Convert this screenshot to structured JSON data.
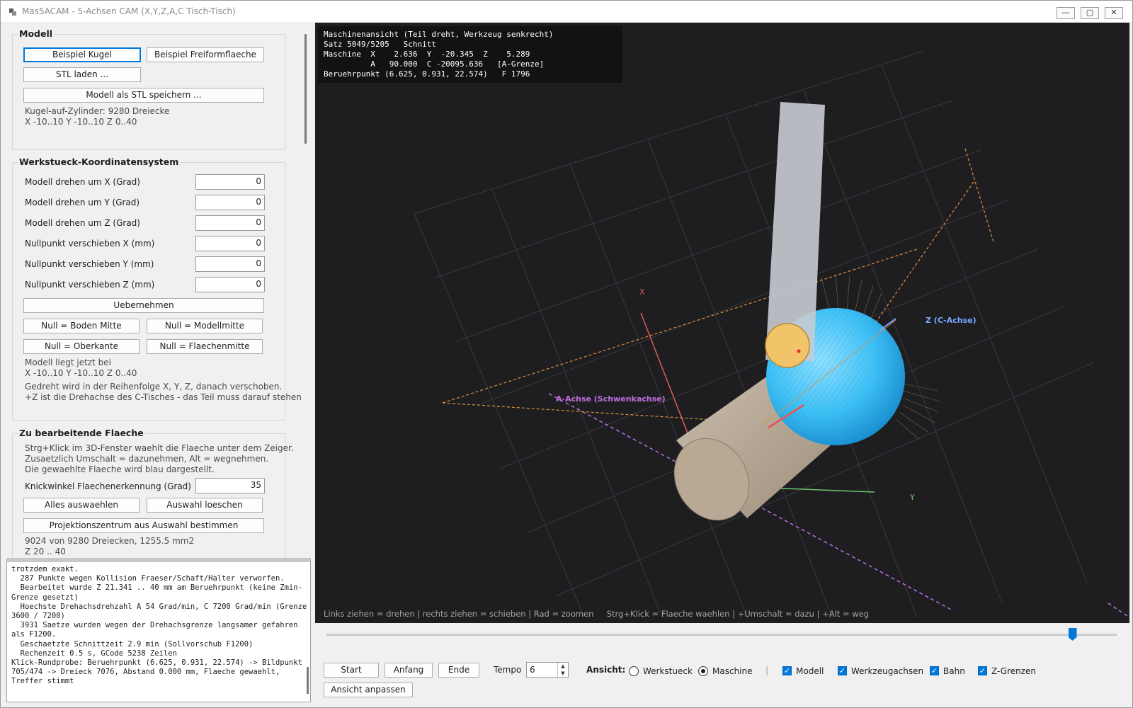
{
  "window": {
    "title": "Mas5ACAM - 5-Achsen CAM (X,Y,Z,A,C Tisch-Tisch)",
    "min_glyph": "—",
    "max_glyph": "▢",
    "close_glyph": "✕"
  },
  "modell": {
    "title": "Modell",
    "btn_kugel": "Beispiel Kugel",
    "btn_freiform": "Beispiel Freiformflaeche",
    "btn_stl_laden": "STL laden ...",
    "btn_stl_speichern": "Modell als STL speichern ...",
    "info1": "Kugel-auf-Zylinder: 9280 Dreiecke",
    "info2": "X -10..10  Y -10..10  Z 0..40"
  },
  "wks": {
    "title": "Werkstueck-Koordinatensystem",
    "rows": [
      {
        "label": "Modell drehen um X (Grad)",
        "value": "0"
      },
      {
        "label": "Modell drehen um Y (Grad)",
        "value": "0"
      },
      {
        "label": "Modell drehen um Z (Grad)",
        "value": "0"
      },
      {
        "label": "Nullpunkt verschieben X (mm)",
        "value": "0"
      },
      {
        "label": "Nullpunkt verschieben Y (mm)",
        "value": "0"
      },
      {
        "label": "Nullpunkt verschieben Z (mm)",
        "value": "0"
      }
    ],
    "btn_uebernehmen": "Uebernehmen",
    "btn_boden_mitte": "Null = Boden Mitte",
    "btn_modellmitte": "Null = Modellmitte",
    "btn_oberkante": "Null = Oberkante",
    "btn_flaechenmitte": "Null = Flaechenmitte",
    "info1": "Modell liegt jetzt bei",
    "info2": "X -10..10   Y -10..10   Z 0..40",
    "info3": "Gedreht wird in der Reihenfolge X, Y, Z, danach verschoben.",
    "info4": "+Z ist die Drehachse des C-Tisches - das Teil muss darauf stehen."
  },
  "flaeche": {
    "title": "Zu bearbeitende Flaeche",
    "info1": "Strg+Klick im 3D-Fenster waehlt die Flaeche unter dem Zeiger.",
    "info2": "Zusaetzlich Umschalt = dazunehmen, Alt = wegnehmen.",
    "info3": "Die gewaehlte Flaeche wird blau dargestellt.",
    "knick_label": "Knickwinkel Flaechenerkennung (Grad)",
    "knick_value": "35",
    "btn_alles": "Alles auswaehlen",
    "btn_loeschen": "Auswahl loeschen",
    "btn_projektion": "Projektionszentrum aus Auswahl bestimmen",
    "info4": "9024 von 9280 Dreiecken, 1255.5 mm2",
    "info5": "Z 20 .. 40"
  },
  "log": {
    "lines": [
      "trotzdem exakt.",
      "  287 Punkte wegen Kollision Fraeser/Schaft/Halter verworfen.",
      "  Bearbeitet wurde Z 21.341 .. 40 mm am Beruehrpunkt (keine Zmin-",
      "Grenze gesetzt)",
      "  Hoechste Drehachsdrehzahl A 54 Grad/min, C 7200 Grad/min (Grenze",
      "3600 / 7200)",
      "  3931 Saetze wurden wegen der Drehachsgrenze langsamer gefahren",
      "als F1200.",
      "  Geschaetzte Schnittzeit 2.9 min (Sollvorschub F1200)",
      "  Rechenzeit 0.5 s, GCode 5238 Zeilen",
      "Klick-Rundprobe: Beruehrpunkt (6.625, 0.931, 22.574) -> Bildpunkt",
      "705/474 -> Dreieck 7076, Abstand 0.000 mm, Flaeche gewaehlt,",
      "Treffer stimmt"
    ]
  },
  "viewport": {
    "overlay_lines": [
      "Maschinenansicht (Teil dreht, Werkzeug senkrecht)",
      "Satz 5049/5205   Schnitt",
      "Maschine  X    2.636  Y  -20.345  Z    5.289",
      "          A   90.000  C -20095.636   [A-Grenze]",
      "Beruehrpunkt (6.625, 0.931, 22.574)   F 1796"
    ],
    "label_x": "X",
    "label_y": "Y",
    "label_z": "Z (C-Achse)",
    "label_a": "A-Achse (Schwenkachse)",
    "hint": "Links ziehen = drehen | rechts ziehen = schieben | Rad = zoomen     Strg+Klick = Flaeche waehlen | +Umschalt = dazu | +Alt = weg",
    "colors": {
      "background": "#1e1e21",
      "x_axis": "#e05a5a",
      "y_axis": "#6ec86e",
      "z_axis": "#7aa7ff",
      "a_axis": "#c06ee0",
      "selection": "#3cc0f5",
      "tool": "#c8cbd2",
      "cutter_ball": "#f2c46a",
      "cylinder": "#b8a894",
      "path": "#e0913c"
    }
  },
  "playback": {
    "position": 0.944,
    "start": "Start",
    "anfang": "Anfang",
    "ende": "Ende",
    "tempo_label": "Tempo",
    "tempo_value": "6",
    "ansicht_label": "Ansicht:",
    "werkstueck": "Werkstueck",
    "maschine": "Maschine",
    "selected_view": "Maschine",
    "separator": "|",
    "chk_modell": "Modell",
    "chk_werkzeugachsen": "Werkzeugachsen",
    "chk_bahn": "Bahn",
    "chk_zgrenzen": "Z-Grenzen",
    "checked": [
      true,
      true,
      true,
      true
    ],
    "ansicht_anpassen": "Ansicht anpassen",
    "spin_up": "▲",
    "spin_down": "▼",
    "check_glyph": "✓"
  }
}
